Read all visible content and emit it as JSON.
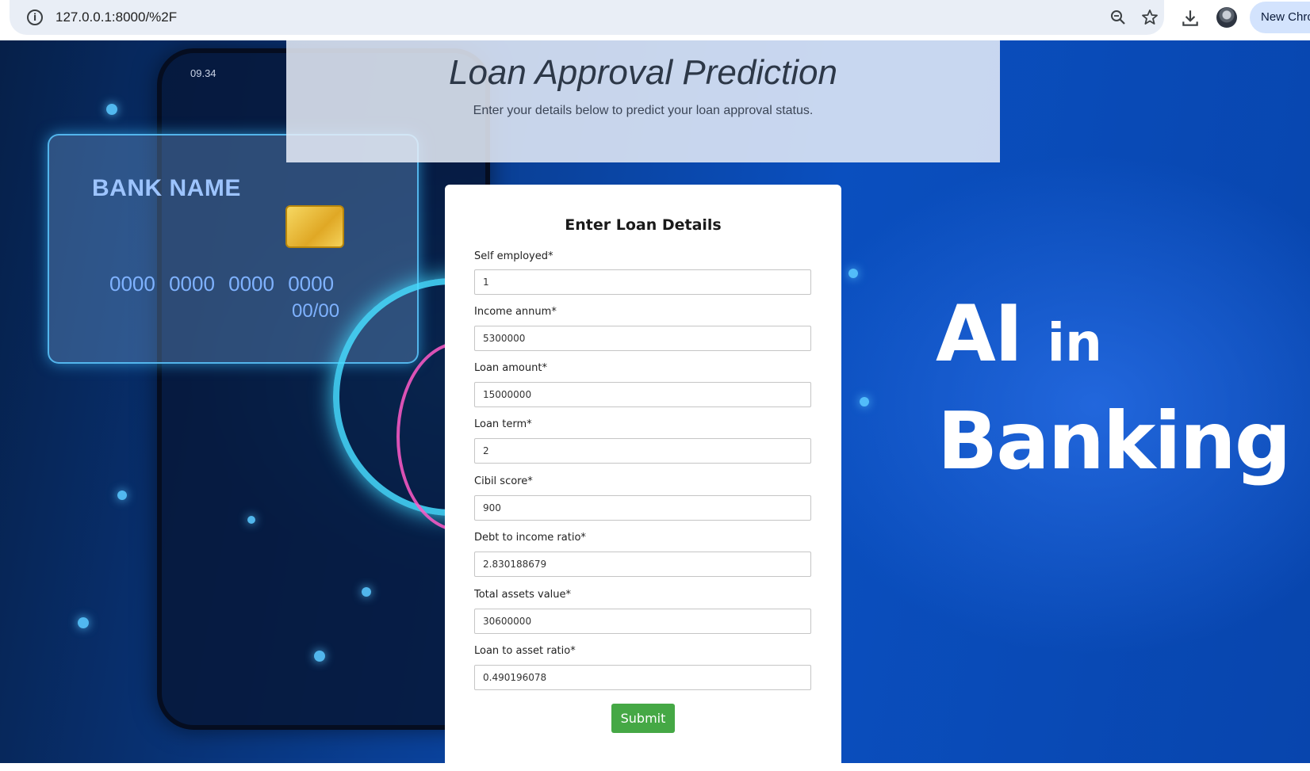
{
  "browser": {
    "url": "127.0.0.1:8000/%2F",
    "new_chrome_label": "New Chrome",
    "icons": [
      "info-icon",
      "zoom-icon",
      "star-icon",
      "download-icon",
      "profile-avatar"
    ]
  },
  "background": {
    "phone_time": "09.34",
    "card_bank_name": "BANK NAME",
    "card_number": "0000 0000 0000 0000",
    "card_expiry": "00/00",
    "headline_ai": "AI",
    "headline_in": "in",
    "headline_banking": "Banking"
  },
  "header": {
    "title": "Loan Approval Prediction",
    "subtitle": "Enter your details below to predict your loan approval status."
  },
  "form": {
    "title": "Enter Loan Details",
    "fields": [
      {
        "label": "Self employed*",
        "value": "1"
      },
      {
        "label": "Income annum*",
        "value": "5300000"
      },
      {
        "label": "Loan amount*",
        "value": "15000000"
      },
      {
        "label": "Loan term*",
        "value": "2"
      },
      {
        "label": "Cibil score*",
        "value": "900"
      },
      {
        "label": "Debt to income ratio*",
        "value": "2.830188679"
      },
      {
        "label": "Total assets value*",
        "value": "30600000"
      },
      {
        "label": "Loan to asset ratio*",
        "value": "0.490196078"
      }
    ],
    "submit_label": "Submit",
    "submit_color": "#45a845"
  }
}
